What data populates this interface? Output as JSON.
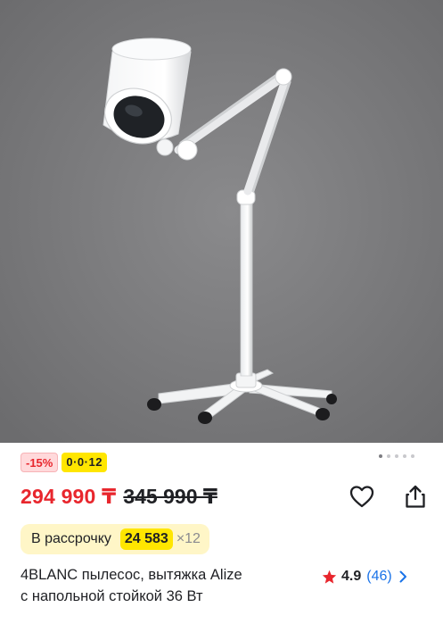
{
  "product": {
    "image_alt": "floor-standing magnifier lamp on a 5-wheel stand",
    "carousel": {
      "dot_count": 5,
      "active_index": 0
    },
    "badges": {
      "discount": "-15%",
      "installment": "0·0·12"
    },
    "price": {
      "current": "294 990 ₸",
      "old": "345 990 ₸"
    },
    "installment": {
      "label": "В рассрочку",
      "amount": "24 583",
      "multiplier": "×12"
    },
    "title_line1": "4BLANC пылесос, вытяжка Alize",
    "title_line2": "с напольной стойкой 36 Вт",
    "rating": {
      "value": "4.9",
      "count": "(46)"
    }
  },
  "icons": {
    "favorite": "heart-outline-icon",
    "share": "share-icon",
    "star": "star-icon",
    "chevron": "chevron-right-icon"
  },
  "colors": {
    "price_red": "#e8262d",
    "accent_yellow": "#ffe600",
    "installment_bg": "#fff6c7",
    "link_blue": "#1a73e8",
    "photo_bg": "#777779"
  }
}
